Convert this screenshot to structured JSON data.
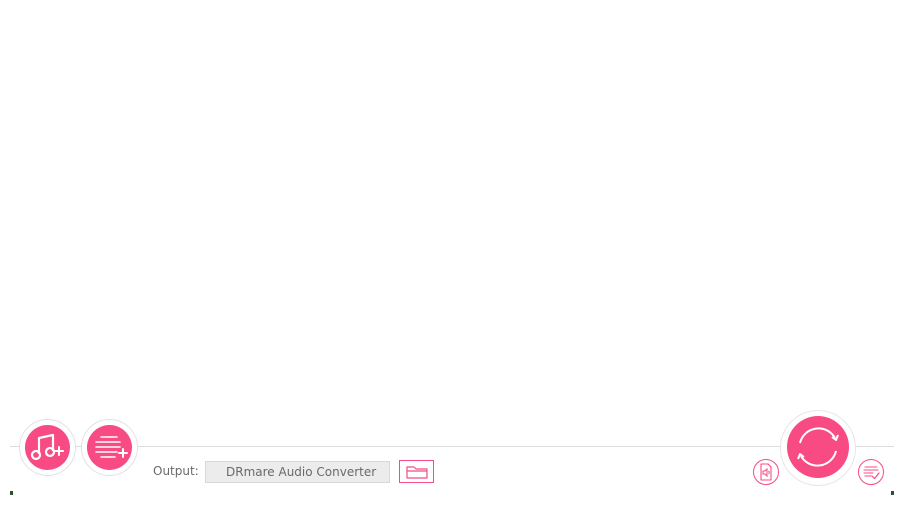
{
  "output": {
    "label": "Output:",
    "path_value": "DRmare Audio Converter"
  },
  "icons": {
    "add_music": "music-note-plus-icon",
    "add_list": "list-plus-icon",
    "open_folder": "folder-icon",
    "audio_settings": "audio-format-icon",
    "convert": "convert-refresh-icon",
    "history": "converted-list-icon"
  },
  "colors": {
    "accent": "#f84a83",
    "field_bg": "#ececec",
    "text": "#6a6a6a"
  }
}
